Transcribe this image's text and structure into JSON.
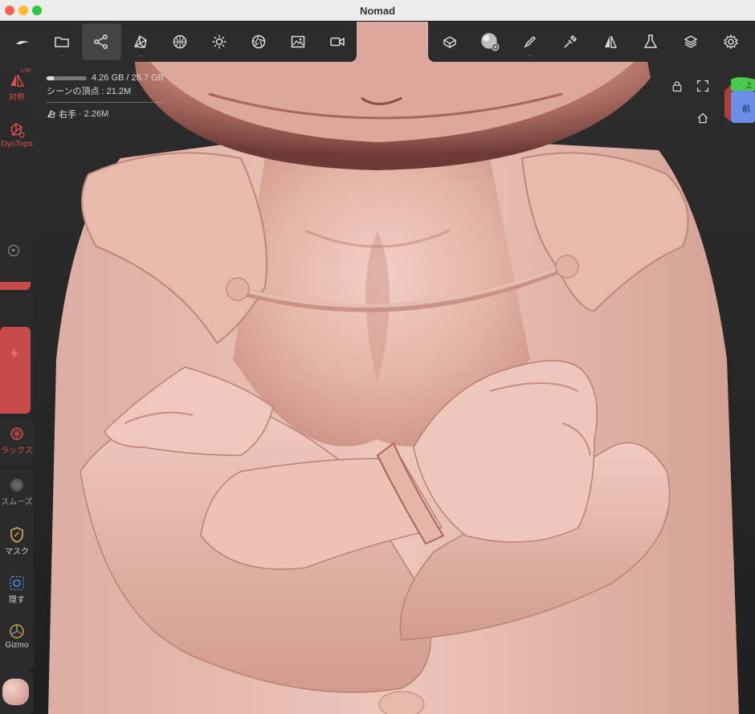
{
  "window": {
    "title": "Nomad"
  },
  "toolbar_left": {
    "items": [
      {
        "name": "nomad-logo-icon"
      },
      {
        "name": "files-icon",
        "dots": "..."
      },
      {
        "name": "scene-icon",
        "dots": ""
      },
      {
        "name": "topology-icon",
        "dots": "..."
      },
      {
        "name": "material-sphere-icon",
        "dots": ""
      },
      {
        "name": "light-icon",
        "dots": ""
      },
      {
        "name": "postprocess-icon",
        "dots": ""
      },
      {
        "name": "background-image-icon",
        "dots": ""
      },
      {
        "name": "camera-icon",
        "dots": ""
      }
    ]
  },
  "toolbar_right": {
    "items": [
      {
        "name": "tools-icon",
        "dots": ""
      },
      {
        "name": "material-ball-icon",
        "dots": ""
      },
      {
        "name": "stroke-icon",
        "dots": "..."
      },
      {
        "name": "brush-settings-icon",
        "dots": ""
      },
      {
        "name": "symmetry-icon",
        "dots": ""
      },
      {
        "name": "flask-icon",
        "dots": ""
      },
      {
        "name": "layers-icon",
        "dots": ""
      },
      {
        "name": "settings-gear-icon",
        "dots": ""
      }
    ]
  },
  "info": {
    "memory": "4.26 GB / 25.7 GB",
    "memory_fraction": 0.17,
    "scene_vertices": "シーンの頂点 : 21.2M",
    "object_name": "右手",
    "object_vertices": "2.26M"
  },
  "left_panel": {
    "symmetry": {
      "label": "対称",
      "corner": "L/W"
    },
    "dyntopo": {
      "label": "DynTopo"
    },
    "relax": {
      "label": "ラックス"
    },
    "smooth": {
      "label": "スムーズ"
    },
    "mask": {
      "label": "マスク"
    },
    "hide": {
      "label": "隠す"
    },
    "gizmo": {
      "label": "Gizmo"
    },
    "radius_slider_fraction": 0.06,
    "intensity_slider_fraction": 0.72
  },
  "view_cube": {
    "top": "上",
    "front": "前"
  },
  "colors": {
    "accent": "#d94f4f",
    "panel": "#2b2b2b",
    "skin": "#d9a89a"
  }
}
